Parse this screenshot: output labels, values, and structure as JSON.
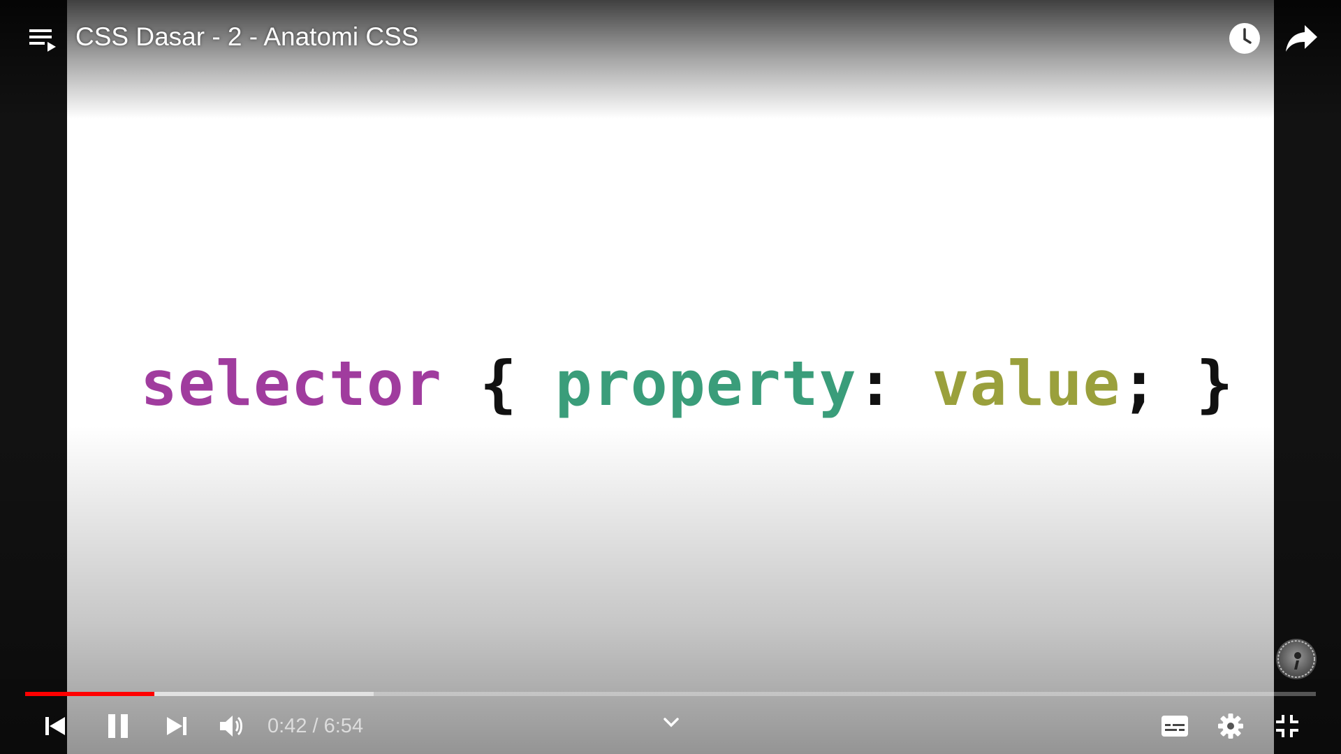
{
  "player": {
    "title": "CSS Dasar - 2 - Anatomi CSS",
    "time": {
      "current": "0:42",
      "separator": " / ",
      "duration": "6:54"
    },
    "progress": {
      "played_fraction": 0.1,
      "buffered_fraction": 0.27
    }
  },
  "video_content": {
    "code": {
      "selector": "selector",
      "open_brace": " { ",
      "property": "property",
      "colon": ": ",
      "value": "value",
      "semicolon": ";",
      "close_brace": " }"
    }
  },
  "colors": {
    "selector": "#a03c9e",
    "property": "#3a9d7a",
    "value": "#9aa03c",
    "punctuation": "#111111",
    "progress_played": "#ff0000"
  },
  "icons": {
    "playlist": "playlist-icon",
    "watch_later": "clock-icon",
    "share": "share-arrow-icon",
    "previous": "skip-previous-icon",
    "pause": "pause-icon",
    "next": "skip-next-icon",
    "volume": "volume-icon",
    "more": "chevron-down-icon",
    "captions": "subtitles-icon",
    "settings": "gear-icon",
    "exit_fullscreen": "exit-fullscreen-icon"
  }
}
